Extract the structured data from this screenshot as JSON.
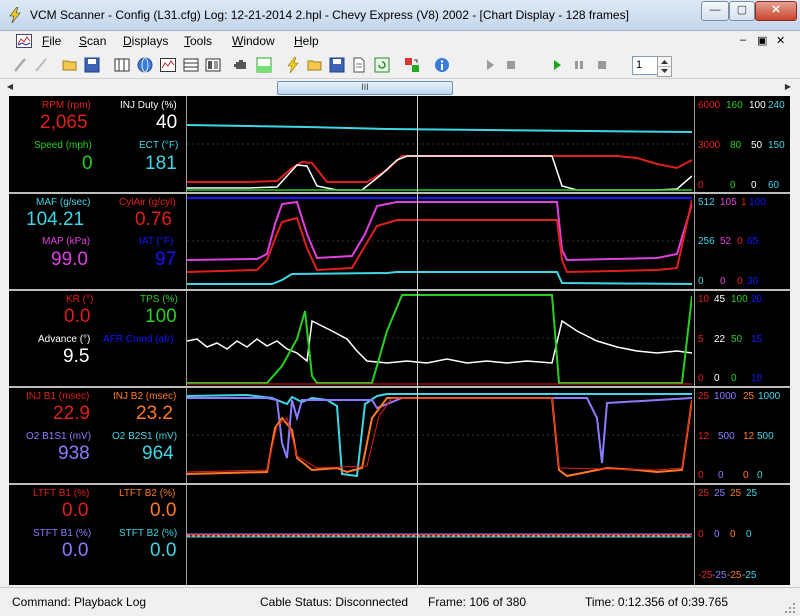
{
  "window": {
    "title": "VCM Scanner  -  Config  (L31.cfg)   Log:  12-21-2014 2.hpl   -   Chevy Express (V8) 2002 - [Chart Display  -  128 frames]",
    "minimize": "—",
    "maximize": "▢",
    "close": "✕"
  },
  "menu": {
    "items": [
      {
        "label": "File",
        "mnemonic": "F",
        "rest": "ile"
      },
      {
        "label": "Scan",
        "mnemonic": "S",
        "rest": "can"
      },
      {
        "label": "Displays",
        "mnemonic": "D",
        "rest": "isplays"
      },
      {
        "label": "Tools",
        "mnemonic": "T",
        "rest": "ools"
      },
      {
        "label": "Window",
        "mnemonic": "W",
        "rest": "indow"
      },
      {
        "label": "Help",
        "mnemonic": "H",
        "rest": "elp"
      }
    ],
    "mdi_minimize": "–",
    "mdi_restore": "▣",
    "mdi_close": "✕"
  },
  "toolbar": {
    "frame_value": "1"
  },
  "scrollbar": {
    "thumb_grip": "III",
    "left_arrow": "◀",
    "right_arrow": "▶"
  },
  "colors": {
    "red": "#e0201c",
    "white": "#ffffff",
    "green": "#27d020",
    "cyan": "#3fd6e6",
    "magenta": "#e040e0",
    "blue": "#1414ff",
    "orange": "#ff7a20",
    "purple": "#8a7cff",
    "steel": "#6fa3ff"
  },
  "panels": [
    {
      "labels": [
        {
          "name": "RPM (rpm)",
          "value": "2,065",
          "color": "red"
        },
        {
          "name": "INJ Duty (%)",
          "value": "40",
          "color": "white"
        },
        {
          "name": "Speed (mph)",
          "value": "0",
          "color": "green"
        },
        {
          "name": "ECT (°F)",
          "value": "181",
          "color": "cyan"
        }
      ],
      "scale": {
        "top": [
          "6000",
          "160",
          "100",
          "240"
        ],
        "mid": [
          "3000",
          "80",
          "50",
          "150"
        ],
        "bot": [
          "0",
          "0",
          "0",
          "60"
        ]
      }
    },
    {
      "labels": [
        {
          "name": "MAF (g/sec)",
          "value": "104.21",
          "color": "cyan"
        },
        {
          "name": "CylAir (g/cyl)",
          "value": "0.76",
          "color": "red"
        },
        {
          "name": "MAP (kPa)",
          "value": "99.0",
          "color": "magenta"
        },
        {
          "name": "IAT (°F)",
          "value": "97",
          "color": "blue"
        }
      ],
      "scale": {
        "top": [
          "512",
          "105",
          "1",
          "100"
        ],
        "mid": [
          "256",
          "52",
          "0",
          "65"
        ],
        "bot": [
          "0",
          "0",
          "0",
          "30"
        ]
      }
    },
    {
      "labels": [
        {
          "name": "KR (°)",
          "value": "0.0",
          "color": "red"
        },
        {
          "name": "TPS (%)",
          "value": "100",
          "color": "green"
        },
        {
          "name": "Advance (°)",
          "value": "9.5",
          "color": "white"
        },
        {
          "name": "AFR Cmnd (afr)",
          "value": "",
          "color": "blue"
        }
      ],
      "scale": {
        "top": [
          "10",
          "45",
          "100",
          "20"
        ],
        "mid": [
          "5",
          "22",
          "50",
          "15"
        ],
        "bot": [
          "0",
          "0",
          "0",
          "10"
        ]
      }
    },
    {
      "labels": [
        {
          "name": "INJ B1 (msec)",
          "value": "22.9",
          "color": "red"
        },
        {
          "name": "INJ B2 (msec)",
          "value": "23.2",
          "color": "orange"
        },
        {
          "name": "O2 B1S1 (mV)",
          "value": "938",
          "color": "purple"
        },
        {
          "name": "O2 B2S1 (mV)",
          "value": "964",
          "color": "cyan"
        }
      ],
      "scale": {
        "top": [
          "25",
          "1000",
          "25",
          "1000"
        ],
        "mid": [
          "12",
          "500",
          "12",
          "500"
        ],
        "bot": [
          "0",
          "0",
          "0",
          "0"
        ]
      }
    },
    {
      "labels": [
        {
          "name": "LTFT B1 (%)",
          "value": "0.0",
          "color": "red"
        },
        {
          "name": "LTFT B2 (%)",
          "value": "0.0",
          "color": "orange"
        },
        {
          "name": "STFT B1 (%)",
          "value": "0.0",
          "color": "purple"
        },
        {
          "name": "STFT B2 (%)",
          "value": "0.0",
          "color": "cyan"
        }
      ],
      "scale": {
        "top": [
          "25",
          "25",
          "25",
          "25"
        ],
        "mid": [
          "0",
          "0",
          "0",
          "0"
        ],
        "bot": [
          "-25",
          "-25",
          "-25",
          "-25"
        ]
      }
    }
  ],
  "status": {
    "command": "Command:  Playback Log",
    "cable": "Cable Status:  Disconnected",
    "frame": "Frame:  106 of 380",
    "time": "Time:  0:12.356 of 0:39.765"
  }
}
